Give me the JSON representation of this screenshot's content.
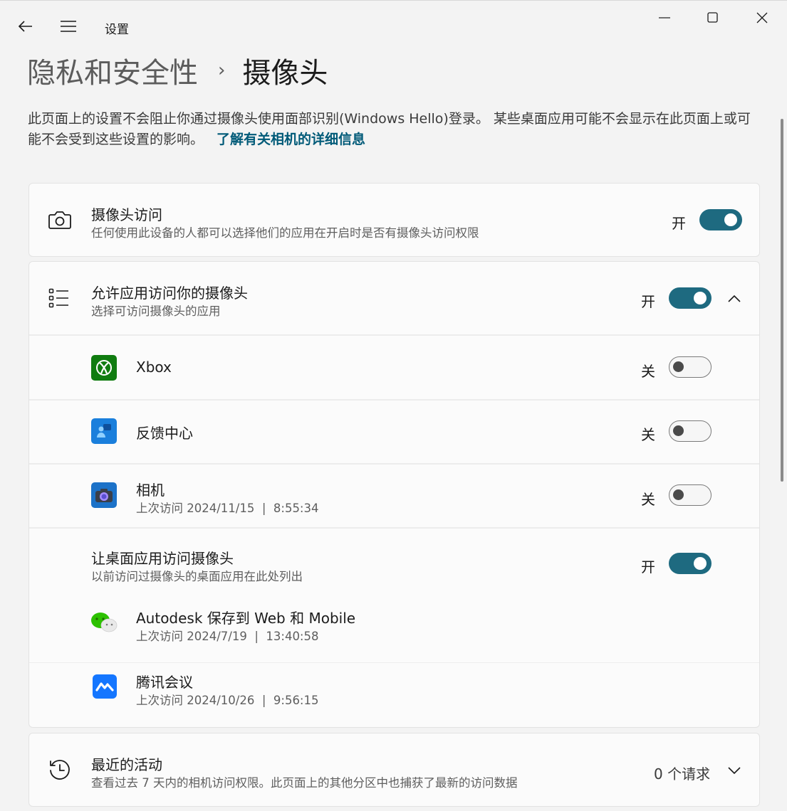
{
  "titlebar": {
    "app_title": "设置",
    "back_icon": "back-arrow-icon",
    "menu_icon": "hamburger-menu-icon",
    "minimize_icon": "minimize-icon",
    "maximize_icon": "maximize-icon",
    "close_icon": "close-icon"
  },
  "breadcrumb": {
    "parent": "隐私和安全性",
    "separator": "›",
    "current": "摄像头"
  },
  "intro": {
    "text": "此页面上的设置不会阻止你通过摄像头使用面部识别(Windows Hello)登录。 某些桌面应用可能不会显示在此页面上或可能不会受到这些设置的影响。",
    "link": "了解有关相机的详细信息"
  },
  "camera_access": {
    "icon": "camera-icon",
    "title": "摄像头访问",
    "subtitle": "任何使用此设备的人都可以选择他们的应用在开启时是否有摄像头访问权限",
    "state": "开",
    "on": true
  },
  "app_access": {
    "icon": "list-icon",
    "title": "允许应用访问你的摄像头",
    "subtitle": "选择可访问摄像头的应用",
    "state": "开",
    "on": true,
    "expanded": true,
    "apps": [
      {
        "name": "Xbox",
        "icon": "xbox-icon",
        "state": "关",
        "on": false,
        "last_access": ""
      },
      {
        "name": "反馈中心",
        "icon": "feedback-hub-icon",
        "state": "关",
        "on": false,
        "last_access": ""
      },
      {
        "name": "相机",
        "icon": "camera-app-icon",
        "state": "关",
        "on": false,
        "last_access": "上次访问 2024/11/15  |  8:55:34"
      }
    ]
  },
  "desktop_access": {
    "title": "让桌面应用访问摄像头",
    "subtitle": "以前访问过摄像头的桌面应用在此处列出",
    "state": "开",
    "on": true,
    "apps": [
      {
        "name": "Autodesk 保存到 Web 和 Mobile",
        "icon": "wechat-icon",
        "last_access": "上次访问 2024/7/19  |  13:40:58"
      },
      {
        "name": "腾讯会议",
        "icon": "tencent-meeting-icon",
        "last_access": "上次访问 2024/10/26  |  9:56:15"
      }
    ]
  },
  "recent_activity": {
    "icon": "history-icon",
    "title": "最近的活动",
    "subtitle": "查看过去 7 天内的相机访问权限。此页面上的其他分区中也捕获了最新的访问数据",
    "count": "0 个请求"
  },
  "colors": {
    "accent": "#1e6a80",
    "link": "#005a78",
    "background": "#f3f3f3",
    "card": "#fbfbfb"
  }
}
